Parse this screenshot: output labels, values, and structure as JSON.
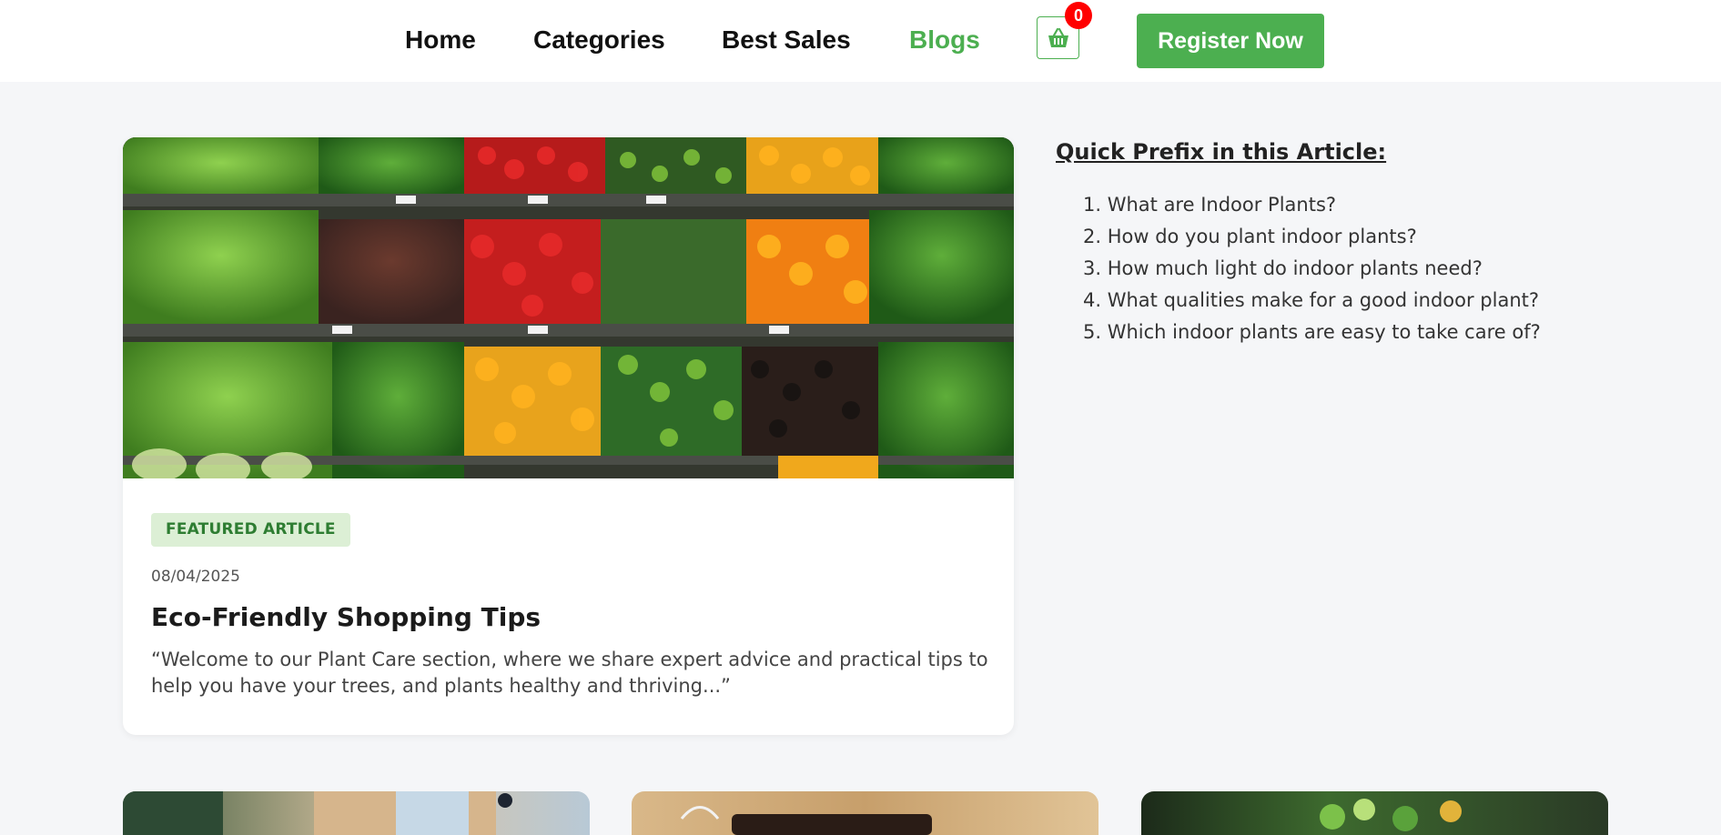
{
  "nav": {
    "links": [
      {
        "label": "Home",
        "active": false
      },
      {
        "label": "Categories",
        "active": false
      },
      {
        "label": "Best Sales",
        "active": false
      },
      {
        "label": "Blogs",
        "active": true
      }
    ],
    "cart_icon": "basket-icon",
    "cart_count": "0",
    "register_label": "Register Now",
    "accent_color": "#4caf50",
    "badge_color": "#ff0000"
  },
  "featured": {
    "image_alt": "produce-shelves-image",
    "badge": "FEATURED ARTICLE",
    "date": "08/04/2025",
    "title": "Eco-Friendly Shopping Tips",
    "excerpt": "“Welcome to our Plant Care section, where we share expert advice and practical tips to help you have your trees, and plants healthy and thriving...”"
  },
  "toc": {
    "title": "Quick Prefix in this Article:",
    "items": [
      "1. What are Indoor Plants?",
      "2. How do you plant indoor plants?",
      "3. How much light do indoor plants need?",
      "4. What qualities make for a good indoor plant?",
      "5. Which indoor plants are easy to take care of?"
    ]
  }
}
